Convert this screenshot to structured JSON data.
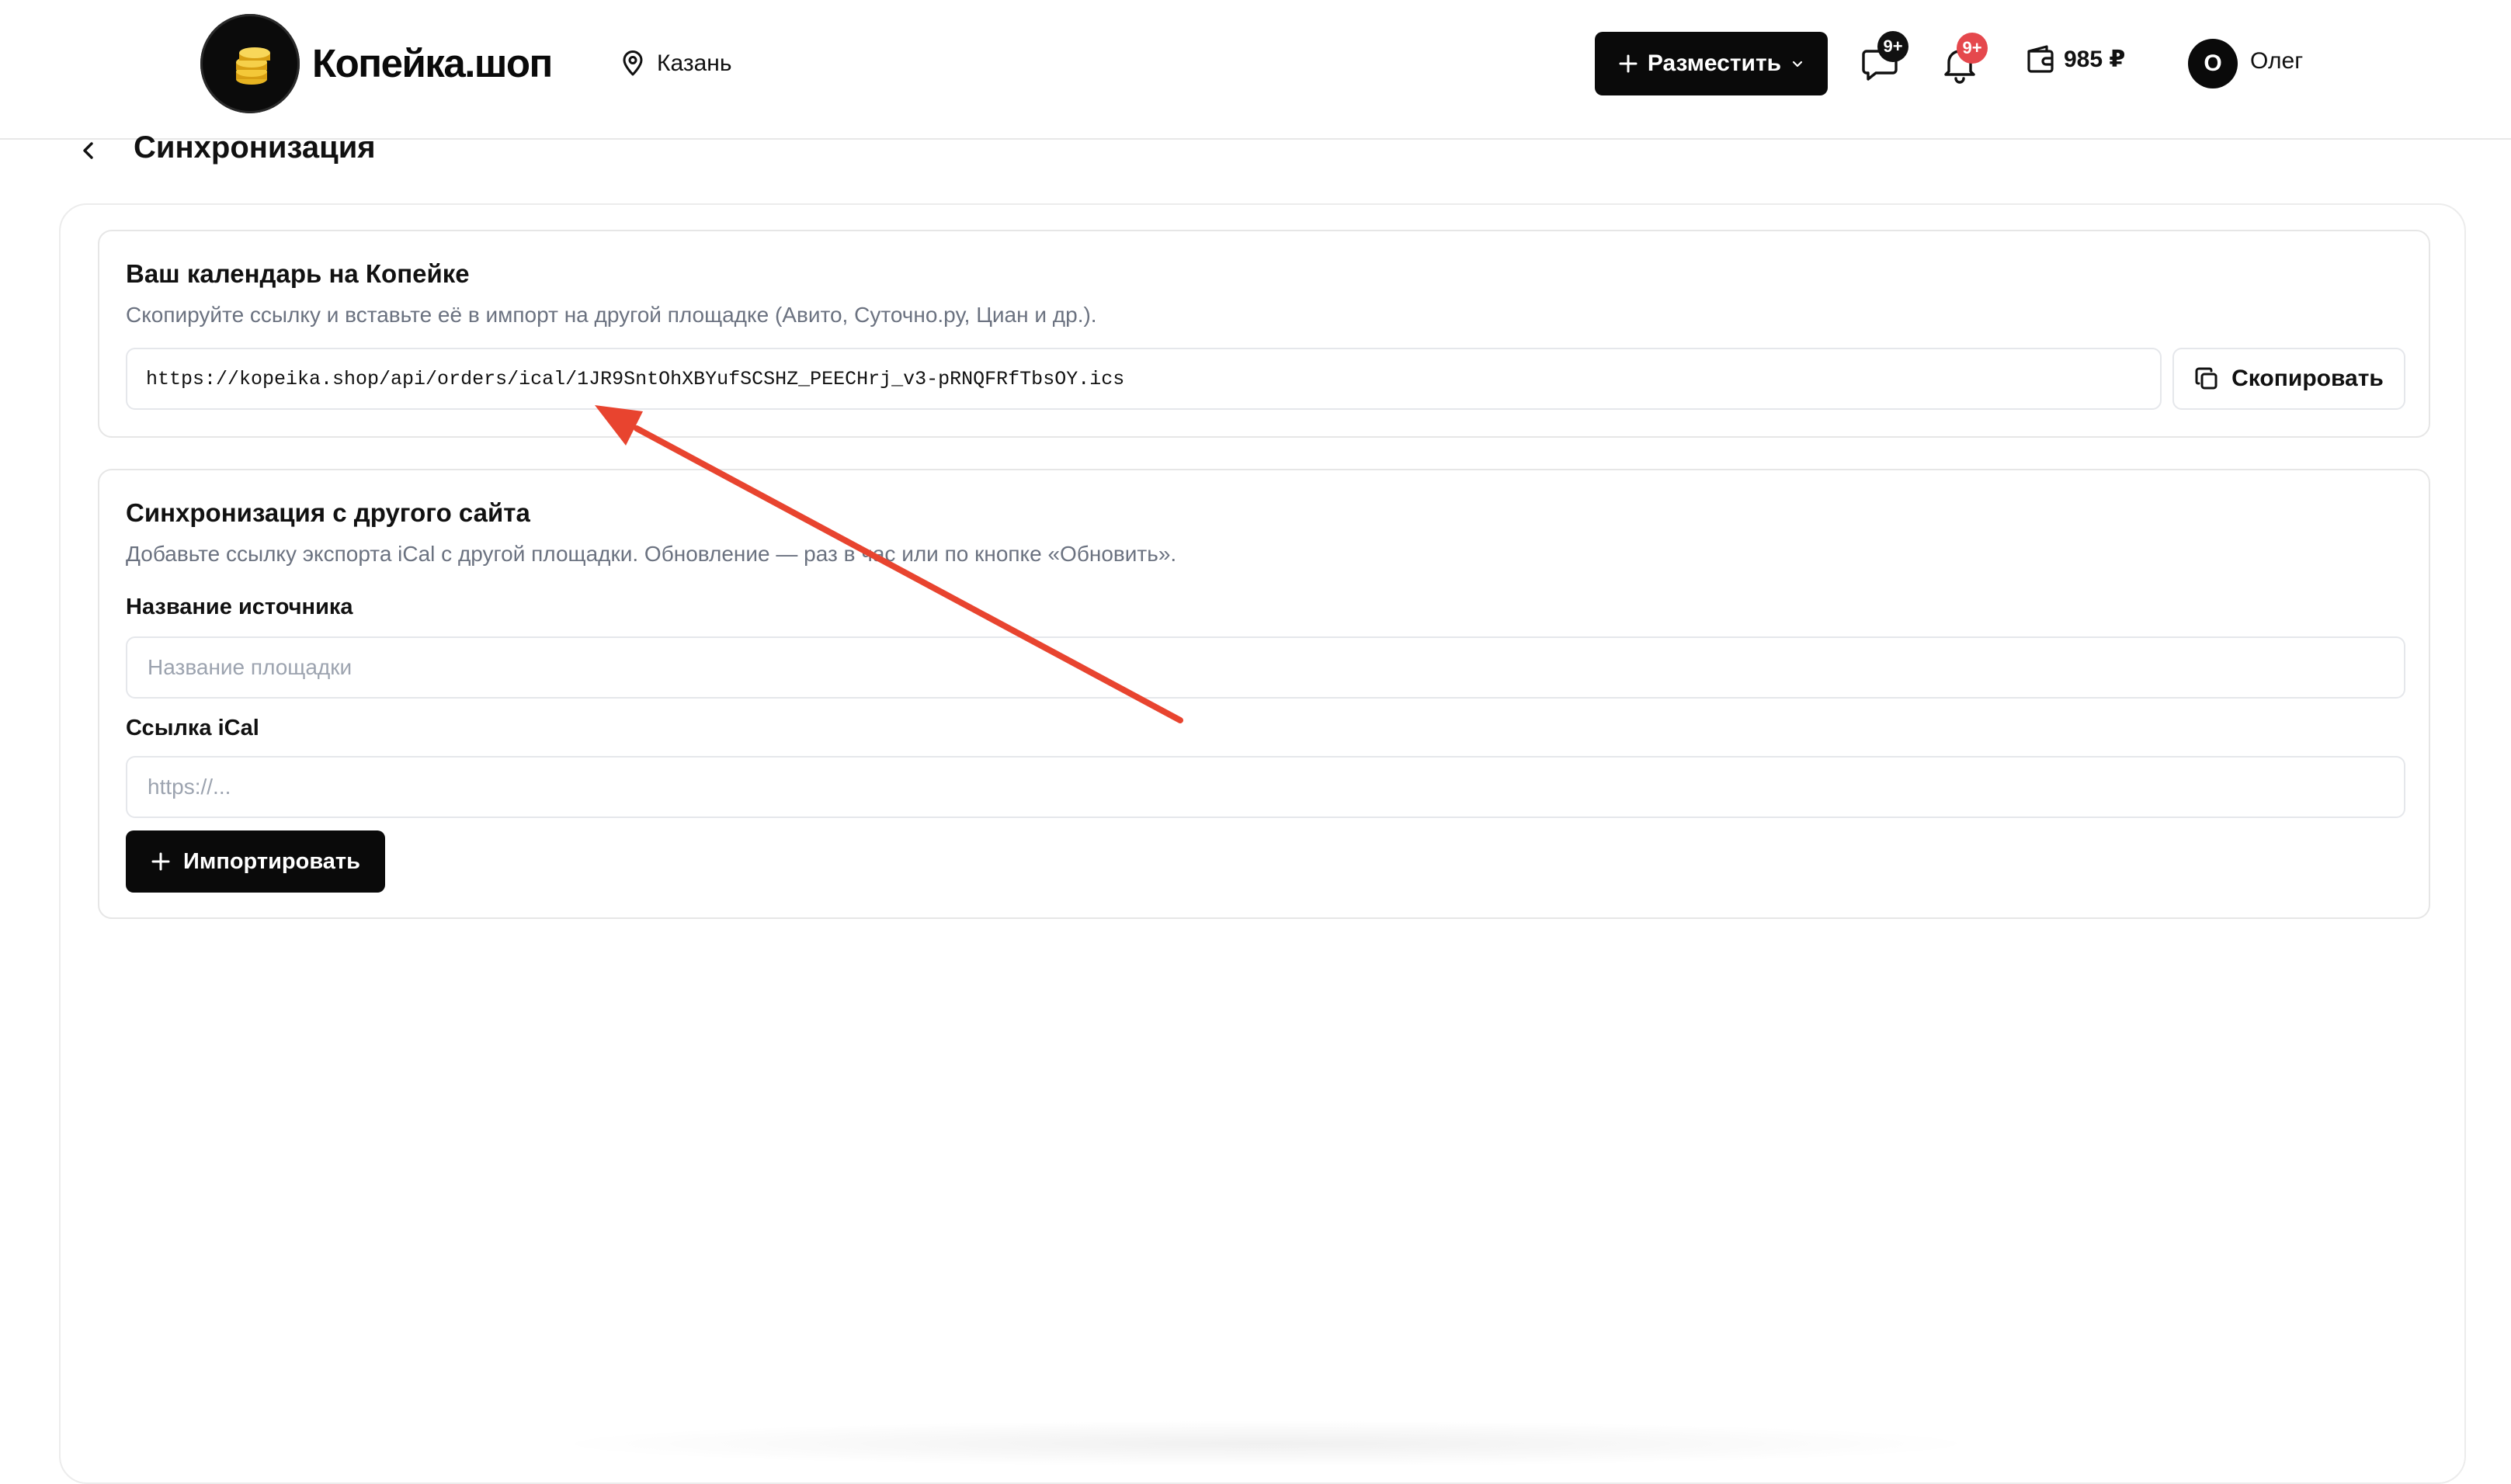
{
  "header": {
    "brand": "Копейка.шоп",
    "city": "Казань",
    "place_button": "Разместить",
    "messages_badge": "9+",
    "notifications_badge": "9+",
    "balance": "985 ₽",
    "user_initial": "О",
    "user_name": "Олег"
  },
  "page": {
    "title": "Синхронизация"
  },
  "export_card": {
    "title": "Ваш календарь на Копейке",
    "description": "Скопируйте ссылку и вставьте её в импорт на другой площадке (Авито, Суточно.ру, Циан и др.).",
    "ical_url": "https://kopeika.shop/api/orders/ical/1JR9SntOhXBYufSCSHZ_PEECHrj_v3-pRNQFRfTbsOY.ics",
    "copy_button": "Скопировать"
  },
  "import_card": {
    "title": "Синхронизация с другого сайта",
    "description": "Добавьте ссылку экспорта iCal с другой площадки. Обновление — раз в час или по кнопке «Обновить».",
    "source_label": "Название источника",
    "source_placeholder": "Название площадки",
    "source_value": "",
    "ical_label": "Ссылка iCal",
    "ical_placeholder": "https://...",
    "ical_value": "",
    "import_button": "Импортировать"
  },
  "colors": {
    "primary": "#0a0a0a",
    "badge_dark": "#111111",
    "badge_red": "#e5484d",
    "annotation_arrow": "#e8442f",
    "muted_text": "#6b7280"
  },
  "icons": {
    "logo": "coin-stack-icon",
    "city": "map-pin-icon",
    "place": "plus-icon",
    "place_dropdown": "chevron-down-icon",
    "messages": "message-icon",
    "notifications": "bell-icon",
    "wallet": "wallet-icon",
    "back": "chevron-left-icon",
    "copy": "copy-icon",
    "import": "plus-icon"
  }
}
